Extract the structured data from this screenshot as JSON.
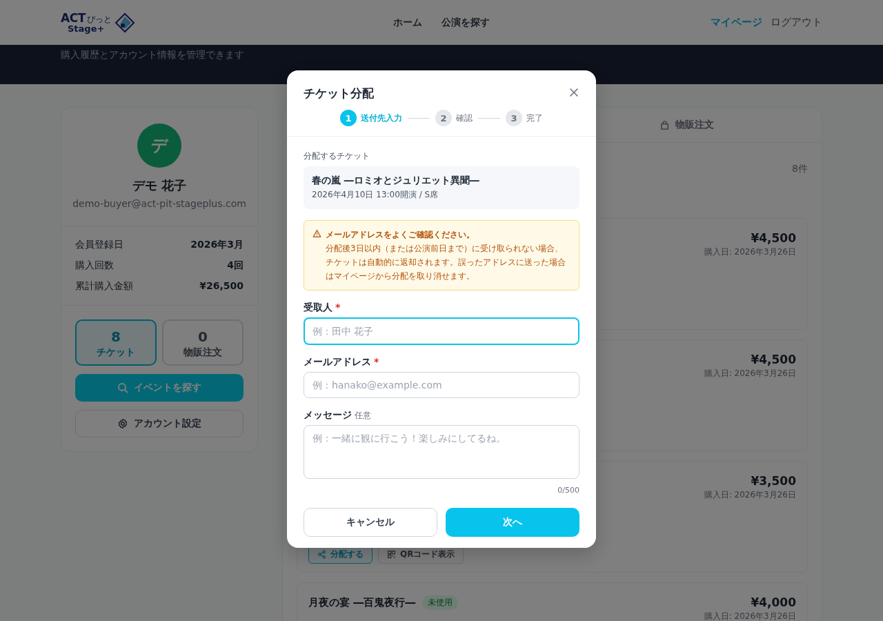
{
  "header": {
    "logo": {
      "word": "ACT",
      "kana": "ぴっと",
      "sub": "Stage+"
    },
    "nav": [
      {
        "label": "ホーム"
      },
      {
        "label": "公演を探す"
      }
    ],
    "user_nav": [
      {
        "label": "マイページ",
        "selected": true
      },
      {
        "label": "ログアウト",
        "selected": false
      }
    ]
  },
  "banner": {
    "subtitle": "購入履歴とアカウント情報を管理できます"
  },
  "profile": {
    "avatar_initial": "デ",
    "name": "デモ 花子",
    "email": "demo-buyer@act-pit-stageplus.com",
    "stats": [
      {
        "label": "会員登録日",
        "value": "2026年3月"
      },
      {
        "label": "購入回数",
        "value": "4回"
      },
      {
        "label": "累計購入金額",
        "value": "¥26,500"
      }
    ],
    "counters": [
      {
        "value": "8",
        "label": "チケット",
        "selected": true
      },
      {
        "value": "0",
        "label": "物販注文",
        "selected": false
      }
    ],
    "buttons": [
      {
        "kind": "primary",
        "label": "イベントを探す"
      },
      {
        "kind": "secondary",
        "label": "アカウント設定"
      }
    ]
  },
  "orders_panel": {
    "tabs": [
      {
        "label": "物販注文",
        "selected": false
      }
    ],
    "count": "8件",
    "orders": [
      {
        "price": "¥4,500",
        "date": "購入日: 2026年3月26日"
      },
      {
        "price": "¥4,500",
        "date": "購入日: 2026年3月26日"
      },
      {
        "price": "¥3,500",
        "date": "購入日: 2026年3月26日",
        "actions": [
          {
            "kind": "primary",
            "label": "分配する"
          },
          {
            "kind": "secondary",
            "label": "QRコード表示"
          }
        ]
      },
      {
        "title": "月夜の宴 ―百鬼夜行―",
        "status": "未使用",
        "price": "¥4,000",
        "date": "購入日: 2026年3月26日"
      }
    ]
  },
  "modal": {
    "title": "チケット分配",
    "steps": [
      {
        "number": "1",
        "label": "送付先入力",
        "selected": true
      },
      {
        "number": "2",
        "label": "確認",
        "selected": false
      },
      {
        "number": "3",
        "label": "完了",
        "selected": false
      }
    ],
    "ticket_label": "分配するチケット",
    "ticket": {
      "title": "春の嵐 ―ロミオとジュリエット異聞―",
      "detail": "2026年4月10日 13:00開演 / S席"
    },
    "warning": {
      "title": "メールアドレスをよくご確認ください。",
      "body": "分配後3日以内（または公演前日まで）に受け取られない場合、チケットは自動的に返却されます。誤ったアドレスに送った場合はマイページから分配を取り消せます。"
    },
    "fields": [
      {
        "kind": "input",
        "label": "受取人",
        "required_mark": "*",
        "placeholder": "例：田中 花子",
        "focused": true
      },
      {
        "kind": "input",
        "label": "メールアドレス",
        "required_mark": "*",
        "placeholder": "例：hanako@example.com",
        "focused": false
      },
      {
        "kind": "textarea",
        "label": "メッセージ",
        "note": "任意",
        "placeholder": "例：一緒に観に行こう！楽しみにしてるね。",
        "focused": false
      }
    ],
    "char_count": "0/500",
    "buttons": [
      {
        "kind": "secondary",
        "label": "キャンセル"
      },
      {
        "kind": "primary",
        "label": "次へ"
      }
    ]
  }
}
